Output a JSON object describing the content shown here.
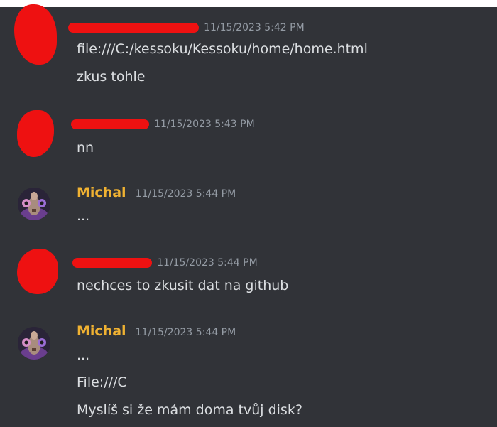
{
  "messages": [
    {
      "author": "",
      "redacted": true,
      "timestamp": "11/15/2023 5:42 PM",
      "lines": [
        "file:///C:/kessoku/Kessoku/home/home.html",
        "zkus tohle"
      ]
    },
    {
      "author": "",
      "redacted": true,
      "timestamp": "11/15/2023 5:43 PM",
      "lines": [
        "nn"
      ]
    },
    {
      "author": "Michal",
      "redacted": false,
      "timestamp": "11/15/2023 5:44 PM",
      "lines": [
        "..."
      ]
    },
    {
      "author": "",
      "redacted": true,
      "timestamp": "11/15/2023 5:44 PM",
      "lines": [
        "nechces to zkusit dat na github"
      ]
    },
    {
      "author": "Michal",
      "redacted": false,
      "timestamp": "11/15/2023 5:44 PM",
      "lines": [
        "...",
        "File:///C",
        "Myslíš si že mám doma tvůj disk?"
      ]
    }
  ],
  "colors": {
    "background": "#313338",
    "username": "#f0b232",
    "timestamp": "#949ba4",
    "text": "#dbdee1",
    "redaction": "#ee1111"
  }
}
